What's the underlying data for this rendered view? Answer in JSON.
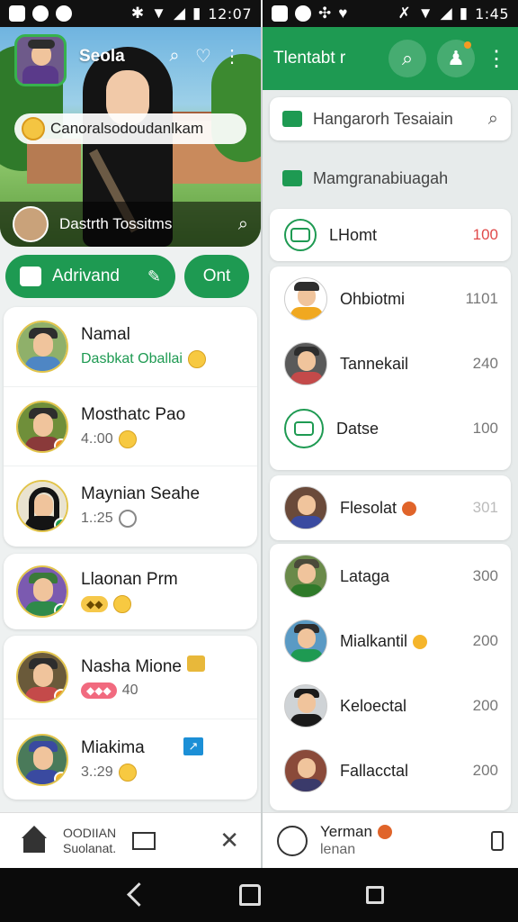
{
  "status_left": {
    "time": "12:07"
  },
  "status_right": {
    "time": "1:45"
  },
  "left": {
    "hero": {
      "title": "Seola",
      "chip_text": "Canoralsodoudanlkam",
      "bottom_text": "Dastrth Tossitms"
    },
    "actions": {
      "primary_label": "Adrivand",
      "secondary_label": "Ont"
    },
    "chats": [
      {
        "name": "Namal",
        "sub": "Dasbkat Oballai",
        "sub_style": "green",
        "badge": "emoji",
        "avatar_bg": "#8fb06a",
        "body": "#4e86c4",
        "dot": ""
      },
      {
        "name": "Mosthatc Pao",
        "sub": "4.:00",
        "badge": "emoji",
        "avatar_bg": "#6f8f3a",
        "body": "#8a3a3a",
        "dot": "#f08a24"
      },
      {
        "name": "Maynian Seahe",
        "sub": "1.:25",
        "badge": "hollow",
        "avatar_bg": "#e9e3d0",
        "body": "#141414",
        "dot": "#1e9a52"
      }
    ],
    "chats2": [
      {
        "name": "Llaonan Prm",
        "pill": "",
        "badge": "emoji",
        "avatar_bg": "#7b5ab0",
        "body": "#2f8a4a",
        "dot": "#1e9a52"
      }
    ],
    "chats3": [
      {
        "name": "Nasha Mione",
        "pill": "",
        "sub": "40",
        "avatar_bg": "#6a5a3a",
        "body": "#c44a4a",
        "dot": "#f08a24"
      },
      {
        "name": "Miakima",
        "sub": "3.:29",
        "badge": "emoji",
        "avatar_bg": "#4a7a5a",
        "body": "#3a4aa0",
        "dot": "#f5b52b"
      }
    ],
    "bottom": {
      "line1": "OODIIAN",
      "line2": "Suolanat."
    }
  },
  "right": {
    "header_title": "Tlentabt r",
    "search_placeholder": "Hangarorh Tesaiain",
    "section_label": "Mamgranabiuagah",
    "highlight": {
      "name": "LHomt",
      "value": "100"
    },
    "group1": [
      {
        "name": "Ohbiotmi",
        "value": "1101",
        "avatar": "#6fb4e0",
        "body": "#f0a820"
      },
      {
        "name": "Tannekail",
        "value": "240",
        "avatar": "#3a3a3a",
        "body": "#c44a4a"
      },
      {
        "name": "Datse",
        "value": "100",
        "avatar": "icon"
      }
    ],
    "group2": [
      {
        "name": "Flesolat",
        "value": "301",
        "avatar": "#6a4a3a",
        "body": "#3a4aa0"
      }
    ],
    "group3": [
      {
        "name": "Lataga",
        "value": "300",
        "avatar": "#6a8a4a",
        "body": "#2f7a2a"
      },
      {
        "name": "Mialkantil",
        "value": "200",
        "avatar": "#5a9ac4",
        "body": "#1e9a52"
      },
      {
        "name": "Keloectal",
        "value": "200",
        "avatar": "#cfd3d6",
        "body": "#1a1a1a"
      },
      {
        "name": "Fallacctal",
        "value": "200",
        "avatar": "#8a4a3a",
        "body": "#3a3a6a"
      }
    ],
    "bottom": {
      "line1": "Yerman",
      "line2": "lenan"
    }
  }
}
